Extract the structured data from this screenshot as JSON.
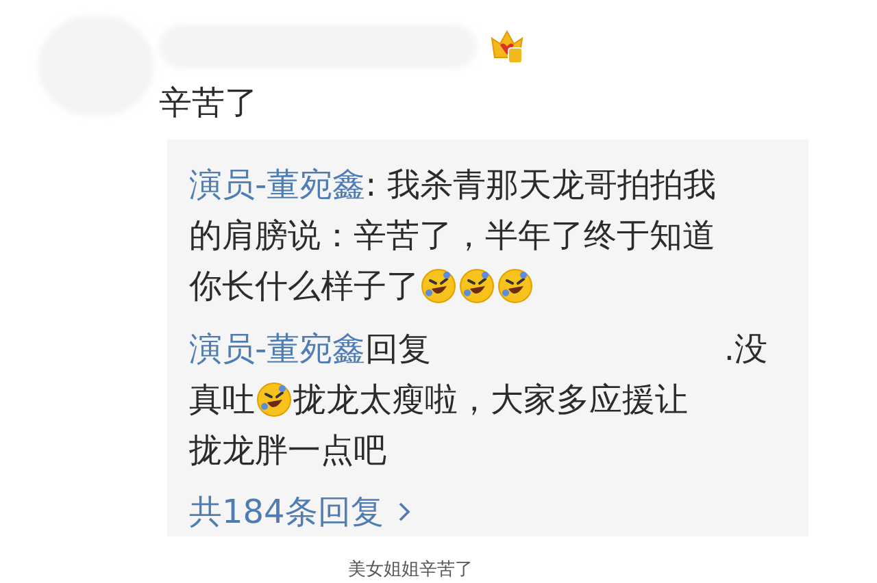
{
  "comment": {
    "text": "辛苦了"
  },
  "replies": {
    "lines": [
      [
        {
          "kind": "author",
          "text": "演员-董宛鑫"
        },
        {
          "kind": "text",
          "text": ": 我杀青那天龙哥拍拍我"
        }
      ],
      [
        {
          "kind": "text",
          "text": "的肩膀说：辛苦了，半年了终于知道"
        }
      ],
      [
        {
          "kind": "text",
          "text": "你长什么样子了"
        },
        {
          "kind": "emoji"
        },
        {
          "kind": "emoji"
        },
        {
          "kind": "emoji"
        }
      ],
      [
        {
          "kind": "author",
          "text": "演员-董宛鑫"
        },
        {
          "kind": "text",
          "text": "回复"
        },
        {
          "kind": "hidden"
        },
        {
          "kind": "text",
          "text": ".没"
        }
      ],
      [
        {
          "kind": "text",
          "text": "真吐"
        },
        {
          "kind": "emoji"
        },
        {
          "kind": "text",
          "text": "拢龙太瘦啦，大家多应援让"
        }
      ],
      [
        {
          "kind": "text",
          "text": "拢龙胖一点吧"
        }
      ]
    ],
    "more_link": "共184条回复"
  },
  "caption": "美女姐姐辛苦了"
}
